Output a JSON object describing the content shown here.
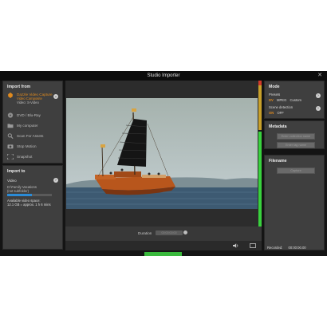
{
  "window": {
    "title": "Studio Importer"
  },
  "import_from": {
    "heading": "Import from",
    "items": [
      {
        "label": "Dazzle Video Capture",
        "sub1": "Video Composite",
        "sub2": "Video: S-Video",
        "icon": "dazzle-capture-icon"
      },
      {
        "label": "DVD / Blu-Ray",
        "icon": "disc-icon"
      },
      {
        "label": "My computer",
        "icon": "folder-icon"
      },
      {
        "label": "Scan For Assets",
        "icon": "magnifier-icon"
      },
      {
        "label": "Stop Motion",
        "icon": "camera-icon"
      },
      {
        "label": "Snapshot",
        "icon": "snapshot-icon"
      }
    ]
  },
  "import_to": {
    "heading": "Import to",
    "video_label": "Video",
    "path": "D:\\Family Vacations",
    "path_sub": "(not subfolder)",
    "space_label": "Available video space:",
    "space_value": "12.1 GB = approx. 1 h 6 mins",
    "space_fraction": 0.55
  },
  "player": {
    "duration_label": "Duration",
    "duration_value": "00:00:00:00",
    "level_fraction": 0.65
  },
  "mode": {
    "heading": "Mode",
    "presets_label": "Presets",
    "presets": [
      "DV",
      "MPEG",
      "Custom"
    ],
    "scene_label": "Scene detection",
    "scene_options": [
      "ON",
      "OFF"
    ]
  },
  "metadata": {
    "heading": "Metadata",
    "collection_placeholder": "Enter collection name",
    "tag_placeholder": "Enter tag name"
  },
  "filename": {
    "heading": "Filename",
    "value": "Capture"
  },
  "status": {
    "recorded_label": "Recorded:",
    "recorded_value": "00:00:00.00"
  },
  "colors": {
    "accent": "#e08a1e",
    "level": "#39d23e",
    "progress": "#2b8bd6"
  }
}
